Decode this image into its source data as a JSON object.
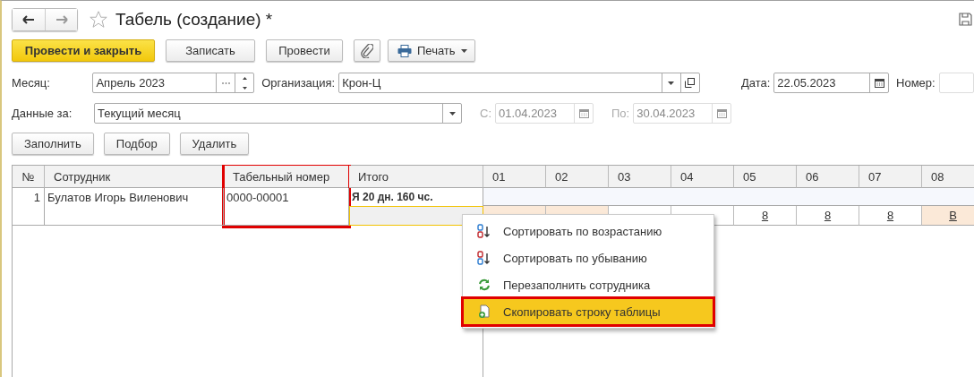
{
  "window": {
    "title": "Табель (создание) *",
    "favorite": false
  },
  "toolbar": [
    {
      "kind": "primary",
      "label": "Провести и закрыть"
    },
    {
      "kind": "plain",
      "label": "Записать"
    },
    {
      "kind": "plain",
      "label": "Провести"
    },
    {
      "kind": "attach"
    },
    {
      "kind": "menu",
      "label": "Печать"
    }
  ],
  "fields": {
    "month": {
      "label": "Месяц:",
      "value": "Апрель 2023"
    },
    "organization": {
      "label": "Организация:",
      "value": "Крон-Ц"
    },
    "date": {
      "label": "Дата:",
      "value": "22.05.2023"
    },
    "number": {
      "label": "Номер:"
    },
    "data_for": {
      "label": "Данные за:",
      "value": "Текущий месяц"
    },
    "from": {
      "label": "С:",
      "value": "01.04.2023",
      "disabled": true
    },
    "to": {
      "label": "По:",
      "value": "30.04.2023",
      "disabled": true
    }
  },
  "table_buttons": [
    "Заполнить",
    "Подбор",
    "Удалить"
  ],
  "table": {
    "columns": [
      {
        "label": "№",
        "highlighted": false
      },
      {
        "label": "Сотрудник",
        "highlighted": false
      },
      {
        "label": "Табельный номер",
        "highlighted": true
      },
      {
        "label": "Итого",
        "highlighted": false
      }
    ],
    "day_columns": [
      "01",
      "02",
      "03",
      "04",
      "05",
      "06",
      "07",
      "08"
    ],
    "rows": [
      {
        "number": "1",
        "employee": "Булатов Игорь Виленович",
        "tab_number": "0000-00001",
        "total": "Я 20 дн. 160 чс.",
        "selected": true,
        "days": [
          {
            "weekend": true
          },
          {
            "weekend": true
          },
          {
            "weekend": false
          },
          {
            "weekend": false
          },
          {
            "value": "8",
            "weekend": false
          },
          {
            "value": "8",
            "weekend": false
          },
          {
            "value": "8",
            "weekend": false
          },
          {
            "value": "В",
            "weekend": true
          }
        ]
      }
    ]
  },
  "context_menu": [
    {
      "kind": "sort-asc",
      "label": "Сортировать по возрастанию",
      "selected": false,
      "highlighted": false
    },
    {
      "kind": "sort-desc",
      "label": "Сортировать по убыванию",
      "selected": false,
      "highlighted": false
    },
    {
      "kind": "refill",
      "label": "Перезаполнить сотрудника",
      "selected": false,
      "highlighted": false
    },
    {
      "kind": "copy-row",
      "label": "Скопировать строку таблицы",
      "selected": true,
      "highlighted": true
    }
  ]
}
